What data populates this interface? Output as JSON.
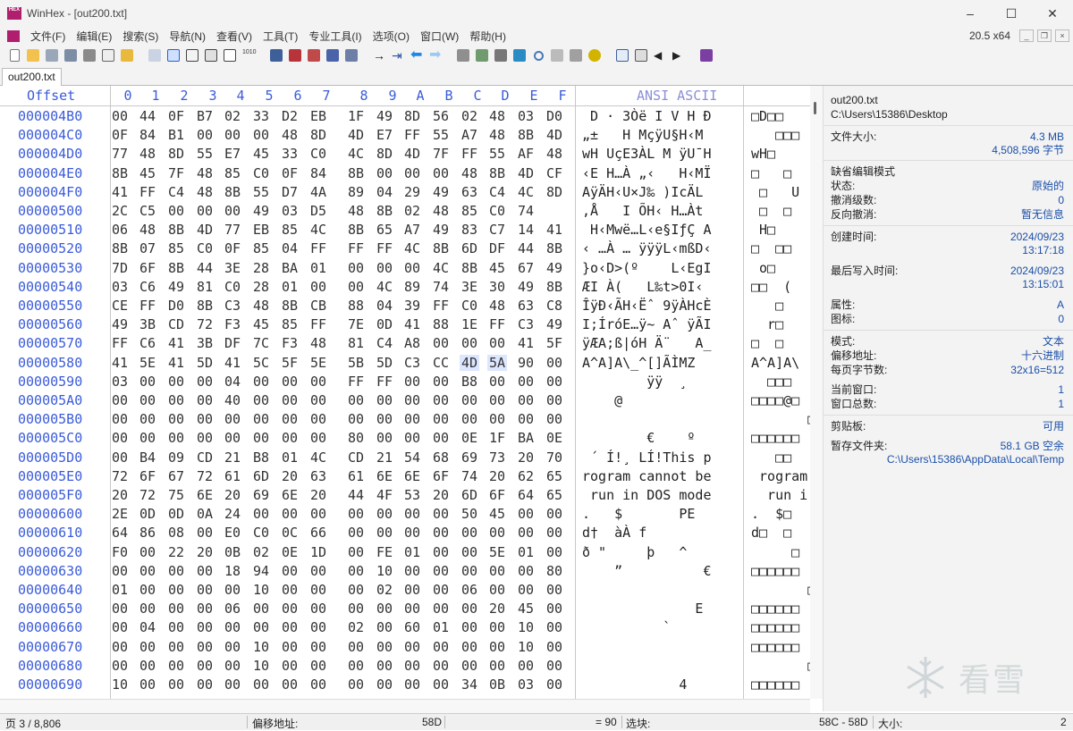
{
  "window": {
    "title": "WinHex - [out200.txt]",
    "version": "20.5 x64"
  },
  "menu": [
    "文件(F)",
    "编辑(E)",
    "搜索(S)",
    "导航(N)",
    "查看(V)",
    "工具(T)",
    "专业工具(I)",
    "选项(O)",
    "窗口(W)",
    "帮助(H)"
  ],
  "tab": {
    "label": "out200.txt"
  },
  "header": {
    "offset": "Offset",
    "cols": [
      "0",
      "1",
      "2",
      "3",
      "4",
      "5",
      "6",
      "7",
      "8",
      "9",
      "A",
      "B",
      "C",
      "D",
      "E",
      "F"
    ],
    "ansi": "ANSI ASCII"
  },
  "rows": [
    {
      "offset": "000004B0",
      "bytes": [
        "00",
        "44",
        "0F",
        "B7",
        "02",
        "33",
        "D2",
        "EB",
        "1F",
        "49",
        "8D",
        "56",
        "02",
        "48",
        "03",
        "D0"
      ],
      "ansi": " D · 3Òë I V H Ð",
      "ascii": "□D□□"
    },
    {
      "offset": "000004C0",
      "bytes": [
        "0F",
        "84",
        "B1",
        "00",
        "00",
        "00",
        "48",
        "8D",
        "4D",
        "E7",
        "FF",
        "55",
        "A7",
        "48",
        "8B",
        "4D"
      ],
      "ansi": "„±   H MçÿU§H‹M",
      "ascii": "   □□□"
    },
    {
      "offset": "000004D0",
      "bytes": [
        "77",
        "48",
        "8D",
        "55",
        "E7",
        "45",
        "33",
        "C0",
        "4C",
        "8D",
        "4D",
        "7F",
        "FF",
        "55",
        "AF",
        "48"
      ],
      "ansi": "wH UçE3ÀL M ÿU¯H",
      "ascii": "wH□"
    },
    {
      "offset": "000004E0",
      "bytes": [
        "8B",
        "45",
        "7F",
        "48",
        "85",
        "C0",
        "0F",
        "84",
        "8B",
        "00",
        "00",
        "00",
        "48",
        "8B",
        "4D",
        "CF"
      ],
      "ansi": "‹E H…À „‹   H‹MÏ",
      "ascii": "□   □"
    },
    {
      "offset": "000004F0",
      "bytes": [
        "41",
        "FF",
        "C4",
        "48",
        "8B",
        "55",
        "D7",
        "4A",
        "89",
        "04",
        "29",
        "49",
        "63",
        "C4",
        "4C",
        "8D"
      ],
      "ansi": "AÿÄH‹U×J‰ )IcÄL",
      "ascii": " □   U"
    },
    {
      "offset": "00000500",
      "bytes": [
        "2C",
        "C5",
        "00",
        "00",
        "00",
        "49",
        "03",
        "D5",
        "48",
        "8B",
        "02",
        "48",
        "85",
        "C0",
        "74"
      ],
      "ansi": ",Å   I ÕH‹ H…Àt",
      "ascii": " □  □"
    },
    {
      "offset": "00000510",
      "bytes": [
        "06",
        "48",
        "8B",
        "4D",
        "77",
        "EB",
        "85",
        "4C",
        "8B",
        "65",
        "A7",
        "49",
        "83",
        "C7",
        "14",
        "41"
      ],
      "ansi": " H‹Mwë…L‹e§IƒÇ A",
      "ascii": " H□"
    },
    {
      "offset": "00000520",
      "bytes": [
        "8B",
        "07",
        "85",
        "C0",
        "0F",
        "85",
        "04",
        "FF",
        "FF",
        "FF",
        "4C",
        "8B",
        "6D",
        "DF",
        "44",
        "8B"
      ],
      "ansi": "‹ …À … ÿÿÿL‹mßD‹",
      "ascii": "□  □□"
    },
    {
      "offset": "00000530",
      "bytes": [
        "7D",
        "6F",
        "8B",
        "44",
        "3E",
        "28",
        "BA",
        "01",
        "00",
        "00",
        "00",
        "4C",
        "8B",
        "45",
        "67",
        "49"
      ],
      "ansi": "}o‹D>(º    L‹EgI",
      "ascii": " o□"
    },
    {
      "offset": "00000540",
      "bytes": [
        "03",
        "C6",
        "49",
        "81",
        "C0",
        "28",
        "01",
        "00",
        "00",
        "4C",
        "89",
        "74",
        "3E",
        "30",
        "49",
        "8B"
      ],
      "ansi": "ÆI À(   L‰t>0I‹",
      "ascii": "□□  ("
    },
    {
      "offset": "00000550",
      "bytes": [
        "CE",
        "FF",
        "D0",
        "8B",
        "C3",
        "48",
        "8B",
        "CB",
        "88",
        "04",
        "39",
        "FF",
        "C0",
        "48",
        "63",
        "C8"
      ],
      "ansi": "ÎÿÐ‹ÃH‹Ëˆ 9ÿÀHcÈ",
      "ascii": "   □"
    },
    {
      "offset": "00000560",
      "bytes": [
        "49",
        "3B",
        "CD",
        "72",
        "F3",
        "45",
        "85",
        "FF",
        "7E",
        "0D",
        "41",
        "88",
        "1E",
        "FF",
        "C3",
        "49"
      ],
      "ansi": "I;ÍróE…ÿ~ Aˆ ÿÃI",
      "ascii": "  r□"
    },
    {
      "offset": "00000570",
      "bytes": [
        "FF",
        "C6",
        "41",
        "3B",
        "DF",
        "7C",
        "F3",
        "48",
        "81",
        "C4",
        "A8",
        "00",
        "00",
        "00",
        "41",
        "5F"
      ],
      "ansi": "ÿÆA;ß|óH Ä¨   A_",
      "ascii": "□  □"
    },
    {
      "offset": "00000580",
      "bytes": [
        "41",
        "5E",
        "41",
        "5D",
        "41",
        "5C",
        "5F",
        "5E",
        "5B",
        "5D",
        "C3",
        "CC",
        "4D",
        "5A",
        "90",
        "00"
      ],
      "ansi": "A^A]A\\_^[]ÃÌMZ",
      "ascii": "A^A]A\\"
    },
    {
      "offset": "00000590",
      "bytes": [
        "03",
        "00",
        "00",
        "00",
        "04",
        "00",
        "00",
        "00",
        "FF",
        "FF",
        "00",
        "00",
        "B8",
        "00",
        "00",
        "00"
      ],
      "ansi": "        ÿÿ  ¸",
      "ascii": "  □□□"
    },
    {
      "offset": "000005A0",
      "bytes": [
        "00",
        "00",
        "00",
        "00",
        "40",
        "00",
        "00",
        "00",
        "00",
        "00",
        "00",
        "00",
        "00",
        "00",
        "00",
        "00"
      ],
      "ansi": "    @",
      "ascii": "□□□□@□"
    },
    {
      "offset": "000005B0",
      "bytes": [
        "00",
        "00",
        "00",
        "00",
        "00",
        "00",
        "00",
        "00",
        "00",
        "00",
        "00",
        "00",
        "00",
        "00",
        "00",
        "00"
      ],
      "ansi": "",
      "ascii": "       □"
    },
    {
      "offset": "000005C0",
      "bytes": [
        "00",
        "00",
        "00",
        "00",
        "00",
        "00",
        "00",
        "00",
        "80",
        "00",
        "00",
        "00",
        "0E",
        "1F",
        "BA",
        "0E"
      ],
      "ansi": "        €    º",
      "ascii": "□□□□□□"
    },
    {
      "offset": "000005D0",
      "bytes": [
        "00",
        "B4",
        "09",
        "CD",
        "21",
        "B8",
        "01",
        "4C",
        "CD",
        "21",
        "54",
        "68",
        "69",
        "73",
        "20",
        "70"
      ],
      "ansi": " ´ Í!¸ LÍ!This p",
      "ascii": "   □□"
    },
    {
      "offset": "000005E0",
      "bytes": [
        "72",
        "6F",
        "67",
        "72",
        "61",
        "6D",
        "20",
        "63",
        "61",
        "6E",
        "6E",
        "6F",
        "74",
        "20",
        "62",
        "65"
      ],
      "ansi": "rogram cannot be",
      "ascii": " rogram"
    },
    {
      "offset": "000005F0",
      "bytes": [
        "20",
        "72",
        "75",
        "6E",
        "20",
        "69",
        "6E",
        "20",
        "44",
        "4F",
        "53",
        "20",
        "6D",
        "6F",
        "64",
        "65"
      ],
      "ansi": " run in DOS mode",
      "ascii": "  run i"
    },
    {
      "offset": "00000600",
      "bytes": [
        "2E",
        "0D",
        "0D",
        "0A",
        "24",
        "00",
        "00",
        "00",
        "00",
        "00",
        "00",
        "00",
        "50",
        "45",
        "00",
        "00"
      ],
      "ansi": ".   $       PE",
      "ascii": ".  $□"
    },
    {
      "offset": "00000610",
      "bytes": [
        "64",
        "86",
        "08",
        "00",
        "E0",
        "C0",
        "0C",
        "66",
        "00",
        "00",
        "00",
        "00",
        "00",
        "00",
        "00",
        "00"
      ],
      "ansi": "d†  àÀ f",
      "ascii": "d□  □"
    },
    {
      "offset": "00000620",
      "bytes": [
        "F0",
        "00",
        "22",
        "20",
        "0B",
        "02",
        "0E",
        "1D",
        "00",
        "FE",
        "01",
        "00",
        "00",
        "5E",
        "01",
        "00"
      ],
      "ansi": "ð \"     þ   ^",
      "ascii": "     □"
    },
    {
      "offset": "00000630",
      "bytes": [
        "00",
        "00",
        "00",
        "00",
        "18",
        "94",
        "00",
        "00",
        "00",
        "10",
        "00",
        "00",
        "00",
        "00",
        "00",
        "80"
      ],
      "ansi": "    ”          €",
      "ascii": "□□□□□□"
    },
    {
      "offset": "00000640",
      "bytes": [
        "01",
        "00",
        "00",
        "00",
        "00",
        "10",
        "00",
        "00",
        "00",
        "02",
        "00",
        "00",
        "06",
        "00",
        "00",
        "00"
      ],
      "ansi": "",
      "ascii": "       □"
    },
    {
      "offset": "00000650",
      "bytes": [
        "00",
        "00",
        "00",
        "00",
        "06",
        "00",
        "00",
        "00",
        "00",
        "00",
        "00",
        "00",
        "00",
        "20",
        "45",
        "00"
      ],
      "ansi": "              E",
      "ascii": "□□□□□□"
    },
    {
      "offset": "00000660",
      "bytes": [
        "00",
        "04",
        "00",
        "00",
        "00",
        "00",
        "00",
        "00",
        "02",
        "00",
        "60",
        "01",
        "00",
        "00",
        "10",
        "00"
      ],
      "ansi": "          `",
      "ascii": "□□□□□□"
    },
    {
      "offset": "00000670",
      "bytes": [
        "00",
        "00",
        "00",
        "00",
        "00",
        "10",
        "00",
        "00",
        "00",
        "00",
        "00",
        "00",
        "00",
        "00",
        "10",
        "00"
      ],
      "ansi": "",
      "ascii": "□□□□□□"
    },
    {
      "offset": "00000680",
      "bytes": [
        "00",
        "00",
        "00",
        "00",
        "00",
        "10",
        "00",
        "00",
        "00",
        "00",
        "00",
        "00",
        "00",
        "00",
        "00",
        "00"
      ],
      "ansi": "",
      "ascii": "       □"
    },
    {
      "offset": "00000690",
      "bytes": [
        "10",
        "00",
        "00",
        "00",
        "00",
        "00",
        "00",
        "00",
        "00",
        "00",
        "00",
        "00",
        "34",
        "0B",
        "03",
        "00"
      ],
      "ansi": "            4",
      "ascii": "□□□□□□"
    }
  ],
  "info": {
    "filename": "out200.txt",
    "path": "C:\\Users\\15386\\Desktop",
    "file_size_label": "文件大小:",
    "file_size": "4.3 MB",
    "file_size_bytes": "4,508,596 字节",
    "edit_mode_label": "缺省编辑模式",
    "state_label": "状态:",
    "state": "原始的",
    "undo_level_label": "撤消级数:",
    "undo_level": "0",
    "redo_label": "反向撤消:",
    "redo": "暂无信息",
    "created_label": "创建时间:",
    "created_date": "2024/09/23",
    "created_time": "13:17:18",
    "modified_label": "最后写入时间:",
    "modified_date": "2024/09/23",
    "modified_time": "13:15:01",
    "attr_label": "属性:",
    "attr": "A",
    "icon_label": "图标:",
    "icon": "0",
    "mode_label": "模式:",
    "mode": "文本",
    "offset_addr_label": "偏移地址:",
    "offset_addr": "十六进制",
    "bytes_per_page_label": "每页字节数:",
    "bytes_per_page": "32x16=512",
    "current_window_label": "当前窗口:",
    "current_window": "1",
    "total_windows_label": "窗口总数:",
    "total_windows": "1",
    "clipboard_label": "剪贴板:",
    "clipboard": "可用",
    "temp_label": "暂存文件夹:",
    "temp_free": "58.1 GB 空余",
    "temp_path": "C:\\Users\\15386\\AppData\\Local\\Temp"
  },
  "status": {
    "page": "页 3 / 8,806",
    "offset_label": "偏移地址:",
    "offset_value": "58D",
    "eq_value": "= 90",
    "selection_label": "选块:",
    "selection_range": "58C - 58D",
    "size_label": "大小:",
    "size_value": "2"
  },
  "watermark": {
    "text": "看雪"
  },
  "colors": {
    "offset_blue": "#3a5bd9",
    "selection": "#dde6ff",
    "info_value": "#1b4fa8"
  }
}
